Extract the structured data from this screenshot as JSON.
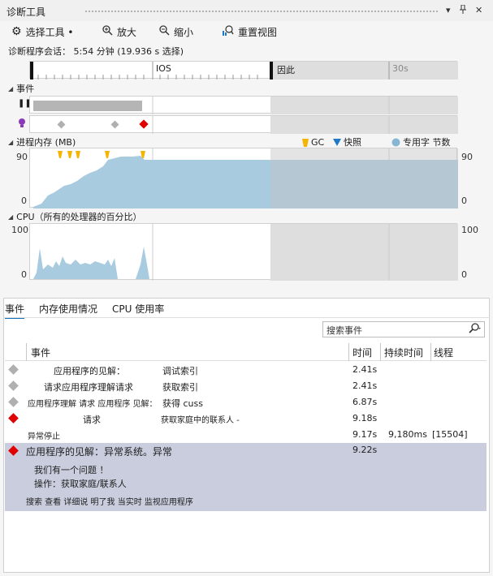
{
  "window": {
    "title": "诊断工具",
    "pin_glyph": "▾",
    "pin2_glyph": "📌",
    "close_glyph": "✕"
  },
  "toolbar": {
    "select_tool": "选择工具 •",
    "zoom_in": "放大",
    "zoom_out": "缩小",
    "reset_view": "重置视图"
  },
  "session_text": "诊断程序会话： 5:54 分钟 (19.936 s 选择)",
  "ruler": {
    "label_a": "IOS",
    "label_b": "因此",
    "label_c": "30s"
  },
  "sections": {
    "events": "事件",
    "memory": "进程内存 (MB)",
    "cpu": "CPU（所有的处理器的百分比）"
  },
  "memory_legend": {
    "gc": "GC",
    "snapshot": "快照",
    "private": "专用字 节数"
  },
  "memory_axis": {
    "top": "90",
    "bottom": "0",
    "top_r": "90",
    "bottom_r": "0"
  },
  "cpu_axis": {
    "top": "100",
    "bottom": "0",
    "top_r": "100",
    "bottom_r": "0"
  },
  "colors": {
    "memory_fill": "#a9cbe0",
    "gc": "#f5b400",
    "snapshot": "#1f78c8",
    "break_event": "#e00000",
    "info_event": "#b0b0b0"
  },
  "tabs": [
    "事件",
    "内存使用情况",
    "CPU 使用率"
  ],
  "search": {
    "placeholder": "搜索事件"
  },
  "table": {
    "headers": {
      "event": "事件",
      "time": "时间",
      "duration": "持续时间",
      "thread": "线程"
    },
    "rows": [
      {
        "icon": "info",
        "left": "应用程序的见解：",
        "right": "调试索引",
        "time": "2.41s",
        "duration": "",
        "thread": ""
      },
      {
        "icon": "info",
        "left": "请求应用程序理解请求",
        "right": "获取索引",
        "time": "2.41s",
        "duration": "",
        "thread": ""
      },
      {
        "icon": "info",
        "left": "应用程序理解 请求 应用程序 见解：",
        "right": "获得 cuss",
        "time": "6.87s",
        "duration": "",
        "thread": ""
      },
      {
        "icon": "break",
        "left": "请求",
        "right": "获取家庭中的联系人 -",
        "time": "9.18s",
        "duration": "",
        "thread": ""
      },
      {
        "icon": "none",
        "left": "异常停止",
        "right": "",
        "time": "9.17s",
        "duration": "9,180ms",
        "thread": "[15504]"
      }
    ],
    "selected": {
      "title": "应用程序的见解：异常系统。异常",
      "time": "9.22s",
      "line1": "我们有一个问题 ！",
      "line2": "操作：获取家庭/联系人",
      "links": "搜索 查看 详细说 明了我   当实时 监视应用程序"
    }
  }
}
